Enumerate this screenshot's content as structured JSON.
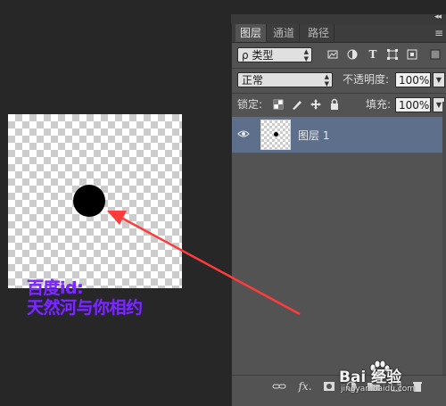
{
  "panel": {
    "collapse_label": "◂◂",
    "tabs": [
      {
        "label": "图层",
        "active": true
      },
      {
        "label": "通道",
        "active": false
      },
      {
        "label": "路径",
        "active": false
      }
    ],
    "menu_icon": "panel-menu-icon",
    "filter": {
      "label": "ρ 类型",
      "icons": [
        "image-filter-icon",
        "adjustment-filter-icon",
        "type-filter-icon",
        "shape-filter-icon",
        "smart-object-filter-icon"
      ]
    },
    "blend": {
      "mode": "正常",
      "opacity_label": "不透明度:",
      "opacity_value": "100%"
    },
    "lock": {
      "label": "锁定:",
      "fill_label": "填充:",
      "fill_value": "100%"
    },
    "layers": [
      {
        "name": "图层 1",
        "visible": true,
        "selected": true
      }
    ],
    "bottom_icons": [
      "link-icon",
      "fx-icon",
      "mask-icon",
      "adjustment-icon",
      "group-icon",
      "new-layer-icon",
      "trash-icon"
    ],
    "fx_label": "fx."
  },
  "canvas": {
    "watermark_line1": "百度id:",
    "watermark_line2": "天然河与你相约"
  },
  "watermark_site": {
    "text": "Bai 经验",
    "url": "jingyan.baidu.com"
  },
  "colors": {
    "panel_bg": "#535353",
    "selected_layer": "#5e6f8c",
    "arrow": "#ff3b3b",
    "watermark": "#7b28ff"
  }
}
